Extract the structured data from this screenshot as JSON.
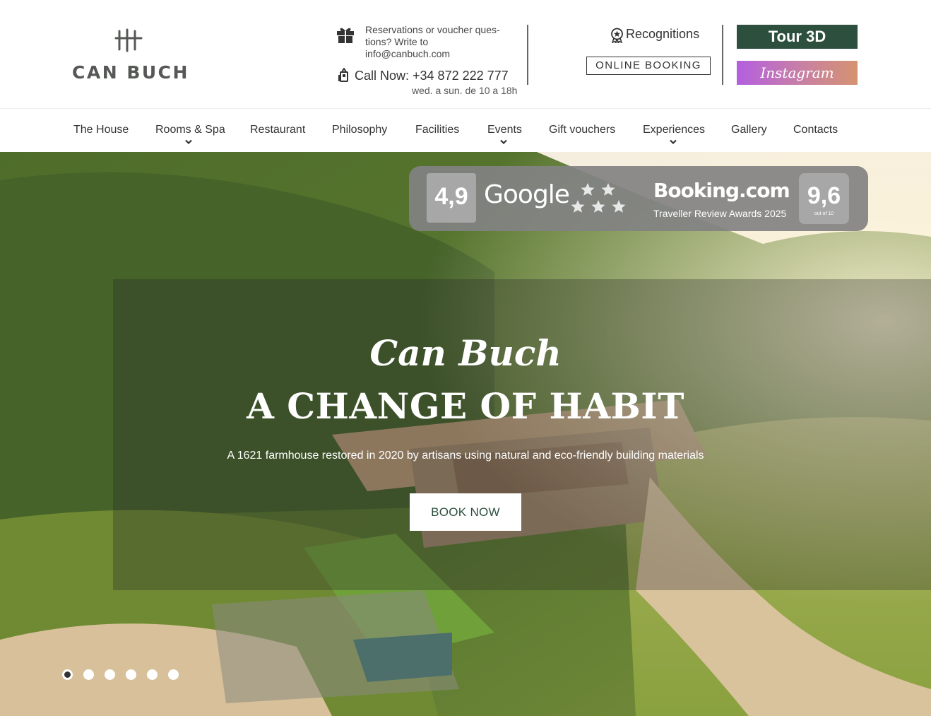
{
  "logo": {
    "text": "CAN BUCH"
  },
  "header": {
    "email_text": "Reservations or voucher ques-tions? Write to info@canbuch.com",
    "call_text": "Call Now: +34 872 222 777",
    "hours": "wed. a sun. de 10 a 18h",
    "recognitions": "Recognitions",
    "online_booking": "ONLINE BOOKING",
    "tour3d": "Tour 3D",
    "instagram": "Instagram"
  },
  "nav": {
    "items": [
      {
        "label": "The House",
        "has_dropdown": false
      },
      {
        "label": "Rooms & Spa",
        "has_dropdown": true
      },
      {
        "label": "Restaurant",
        "has_dropdown": false
      },
      {
        "label": "Philosophy",
        "has_dropdown": false
      },
      {
        "label": "Facilities",
        "has_dropdown": false
      },
      {
        "label": "Events",
        "has_dropdown": true
      },
      {
        "label": "Gift vouchers",
        "has_dropdown": false
      },
      {
        "label": "Experiences",
        "has_dropdown": true
      },
      {
        "label": "Gallery",
        "has_dropdown": false
      },
      {
        "label": "Contacts",
        "has_dropdown": false
      }
    ]
  },
  "reviews": {
    "google_score": "4,9",
    "google_label": "Google",
    "booking_label": "Booking.com",
    "booking_award": "Traveller Review Awards 2025",
    "booking_score": "9,6",
    "booking_score_sub": "out of 10"
  },
  "hero": {
    "script_title": "Can Buch",
    "title": "A CHANGE OF HABIT",
    "subtitle": "A 1621 farmhouse restored in 2020 by artisans using natural and eco-friendly building materials",
    "cta": "BOOK NOW"
  },
  "slider": {
    "count": 6,
    "active": 1
  },
  "colors": {
    "brand_green": "#2c4f3e",
    "logo_grey": "#555855",
    "instagram_gradient": [
      "#b35fe0",
      "#d59370"
    ],
    "review_panel": "#828282"
  }
}
